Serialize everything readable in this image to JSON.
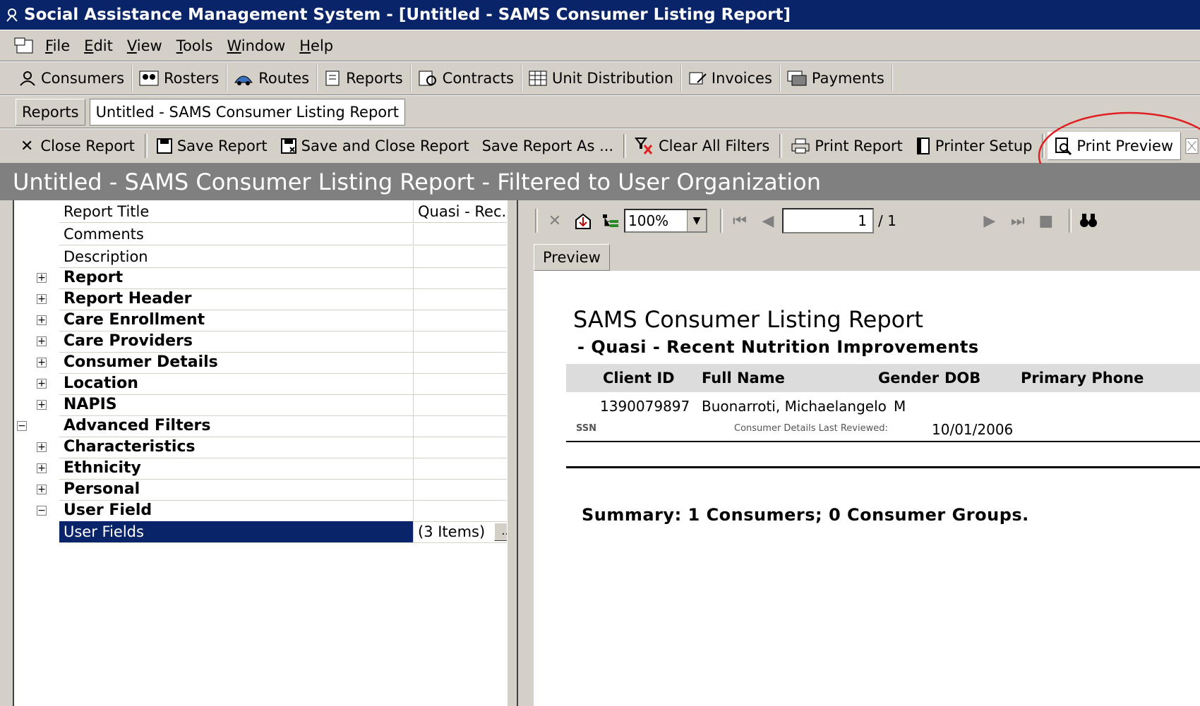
{
  "window": {
    "title": "Social Assistance Management System - [Untitled - SAMS Consumer Listing Report]"
  },
  "menu": [
    "File",
    "Edit",
    "View",
    "Tools",
    "Window",
    "Help"
  ],
  "nav": [
    "Consumers",
    "Rosters",
    "Routes",
    "Reports",
    "Contracts",
    "Unit Distribution",
    "Invoices",
    "Payments"
  ],
  "tabs": [
    "Reports",
    "Untitled - SAMS Consumer Listing Report"
  ],
  "toolbar": {
    "close": "Close Report",
    "save": "Save Report",
    "save_close": "Save and Close Report",
    "save_as": "Save Report As ...",
    "clear_filters": "Clear All Filters",
    "print": "Print Report",
    "printer_setup": "Printer Setup",
    "print_preview": "Print Preview"
  },
  "banner": "Untitled - SAMS Consumer Listing Report - Filtered to User Organization",
  "properties": {
    "report_title_label": "Report Title",
    "report_title_value": "Quasi - Rec...",
    "comments_label": "Comments",
    "description_label": "Description",
    "categories": [
      "Report",
      "Report Header",
      "Care Enrollment",
      "Care Providers",
      "Consumer Details",
      "Location",
      "NAPIS",
      "Advanced Filters",
      "Characteristics",
      "Ethnicity",
      "Personal",
      "User Field"
    ],
    "user_fields_label": "User Fields",
    "user_fields_value": "(3 Items)",
    "ellipsis": "..."
  },
  "preview": {
    "zoom": "100%",
    "page": "1",
    "page_total": "/ 1",
    "tab": "Preview",
    "report_title": "SAMS Consumer Listing Report",
    "report_subtitle": "- Quasi - Recent Nutrition Improvements",
    "columns": [
      "Client ID",
      "Full Name",
      "Gender",
      "DOB",
      "Primary Phone"
    ],
    "row": {
      "client_id": "1390079897",
      "full_name": "Buonarroti, Michaelangelo",
      "gender": "M",
      "ssn_label": "SSN",
      "reviewed_label": "Consumer Details Last Reviewed:",
      "reviewed_date": "10/01/2006"
    },
    "summary": "Summary:  1 Consumers; 0 Consumer Groups."
  },
  "annotation_color": "#e02020"
}
